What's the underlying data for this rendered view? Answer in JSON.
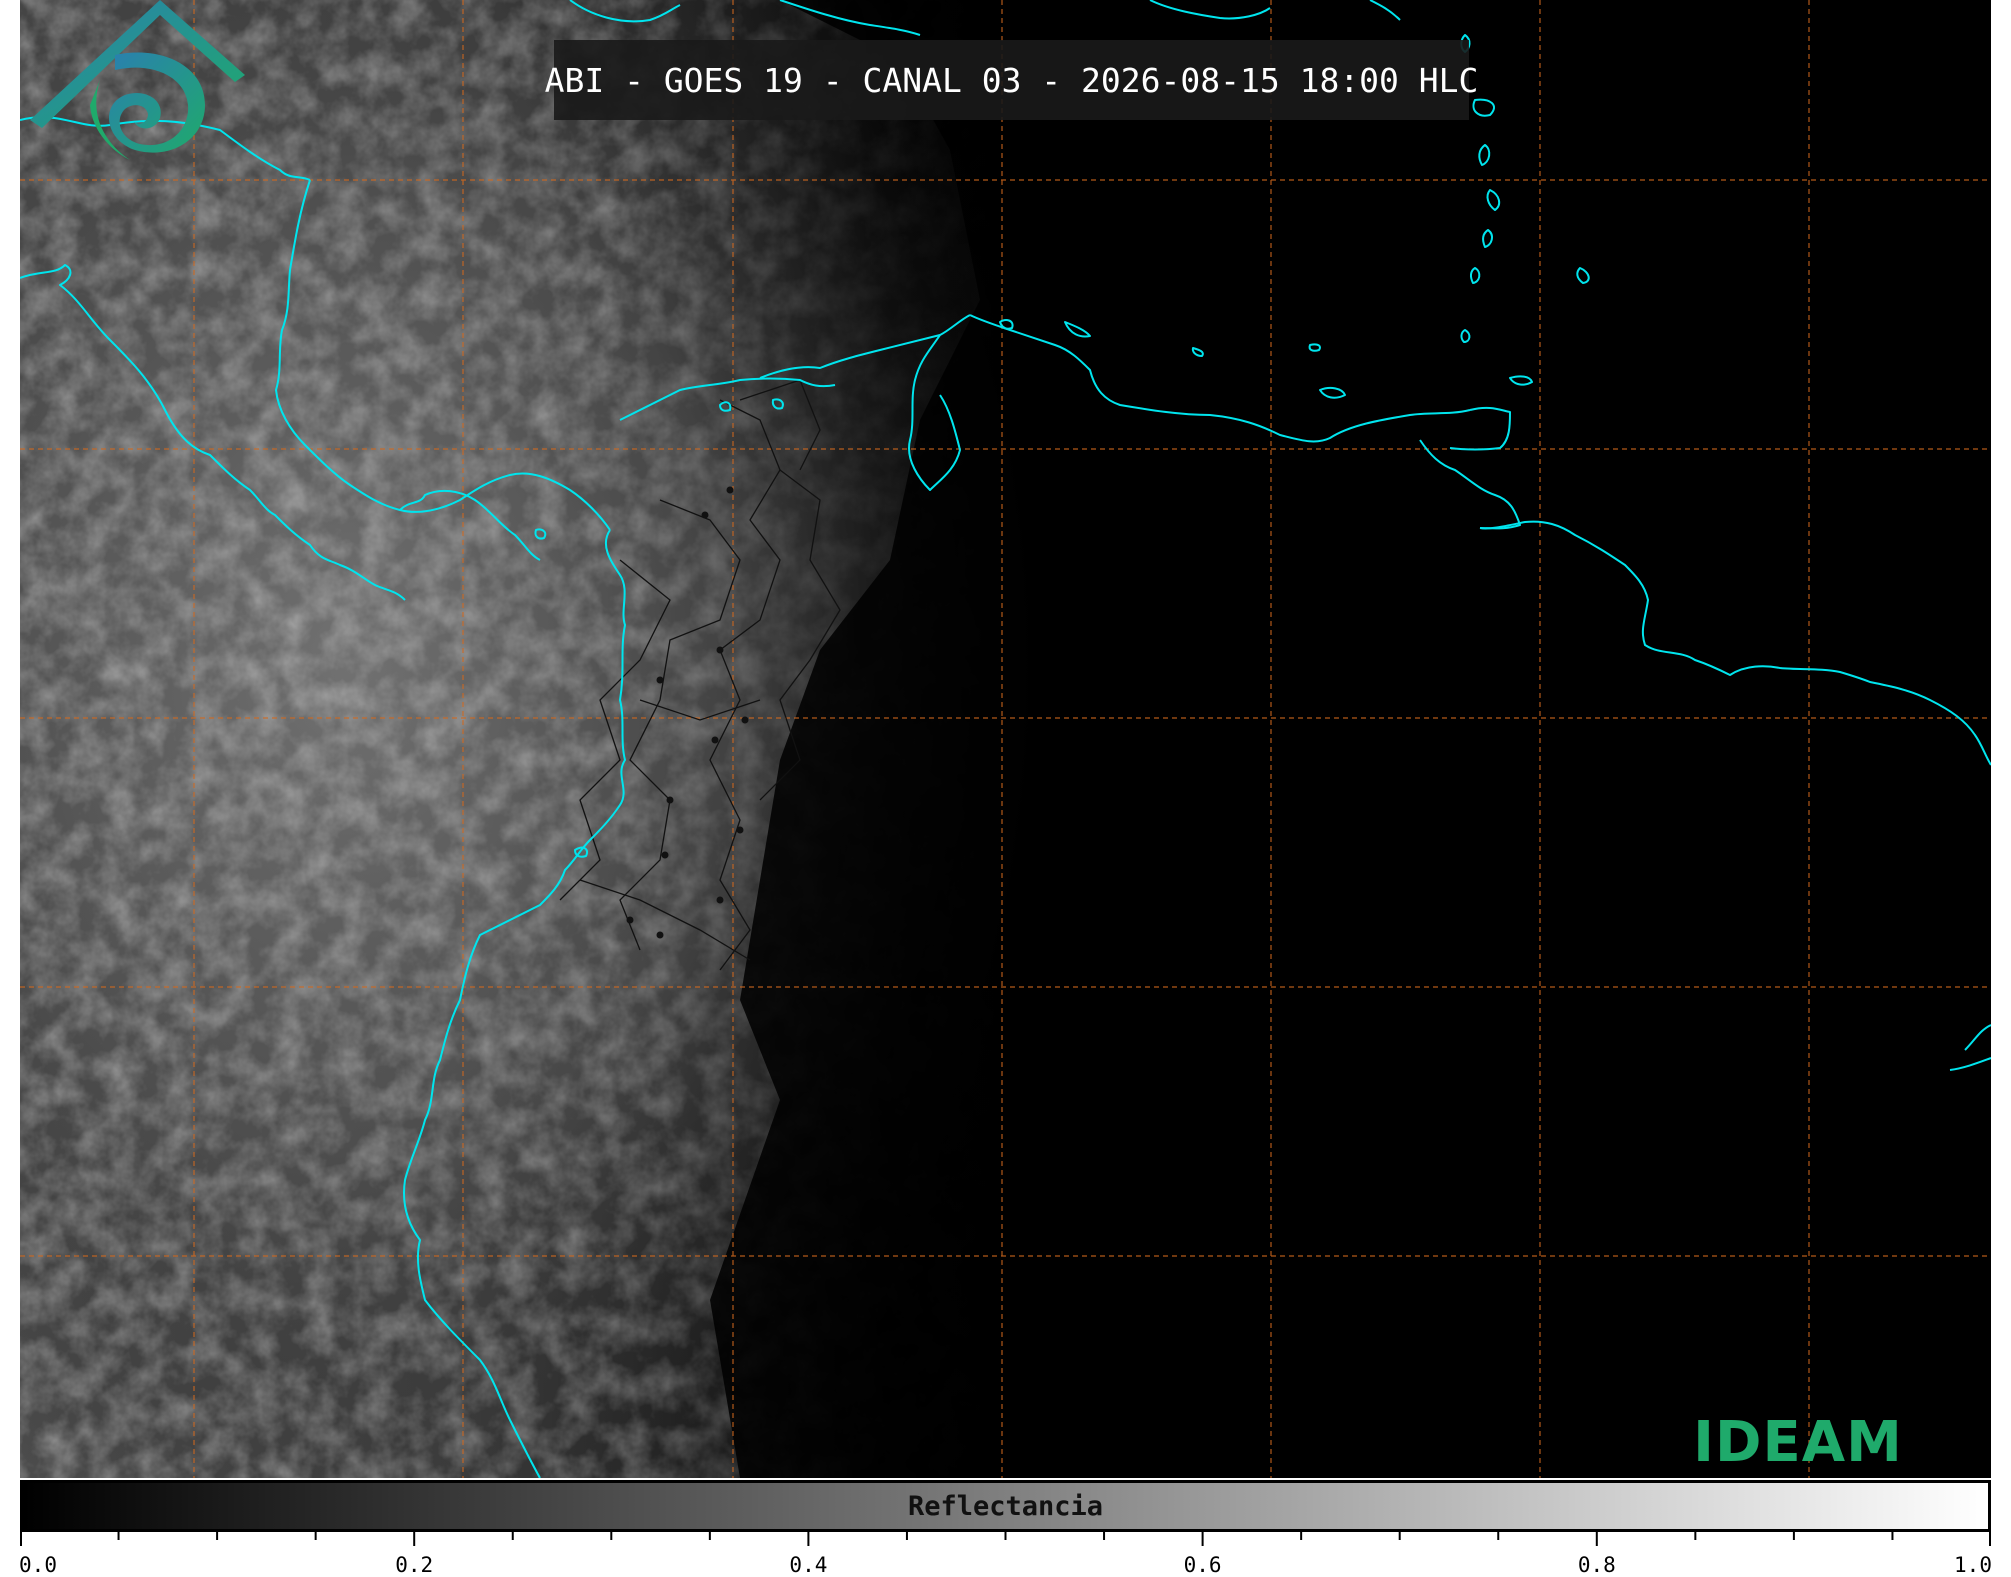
{
  "title": "ABI - GOES 19 - CANAL 03 - 2026-08-15 18:00 HLC",
  "colorbar": {
    "label": "Reflectancia",
    "min": 0.0,
    "max": 1.0,
    "tick_labels": [
      "0.0",
      "0.2",
      "0.4",
      "0.6",
      "0.8",
      "1.0"
    ]
  },
  "logo": {
    "text": "IDEAM",
    "colors": {
      "primary": "#1faa6b",
      "secondary": "#2a7fb0"
    }
  },
  "map": {
    "coastline_color": "#00e5ee",
    "grid_color": "#d2691e",
    "border_color": "#111111",
    "background": "#000000"
  }
}
